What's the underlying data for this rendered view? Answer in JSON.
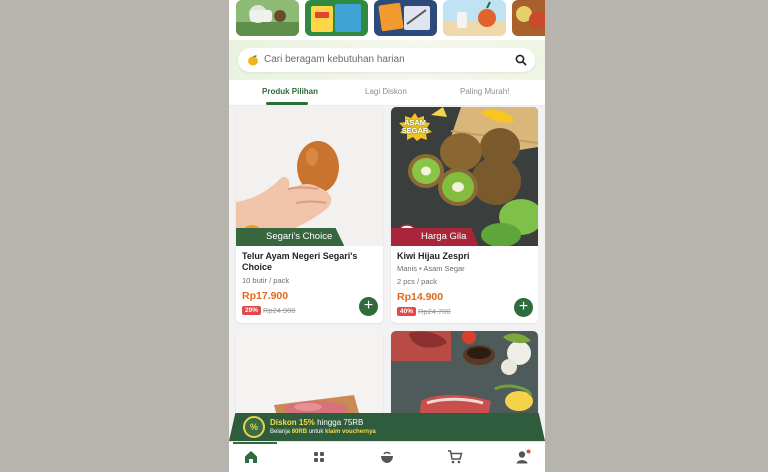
{
  "search": {
    "placeholder": "Cari beragam kebutuhan harian"
  },
  "tabs": [
    {
      "label": "Produk Pilihan",
      "active": true
    },
    {
      "label": "Lagi Diskon",
      "active": false
    },
    {
      "label": "Paling Murah!",
      "active": false
    }
  ],
  "products": [
    {
      "name": "Telur Ayam Negeri Segari's Choice",
      "variant": "",
      "unit": "10 butir / pack",
      "price": "Rp17.900",
      "discount": "29%",
      "old_price": "Rp24.900",
      "ribbon": "Segari's Choice",
      "ribbon_color": "#36673f"
    },
    {
      "name": "Kiwi Hijau Zespri",
      "variant": "Manis • Asam Segar",
      "unit": "2 pcs / pack",
      "price": "Rp14.900",
      "discount": "40%",
      "old_price": "Rp24.700",
      "ribbon": "Harga Gila",
      "ribbon_color": "#a9253a",
      "sticker": {
        "line1": "ASAM",
        "line2": "SEGAR"
      }
    }
  ],
  "promo": {
    "icon_text": "%",
    "line1_a": "Diskon 15%",
    "line1_b": " hingga 75RB",
    "line2_a": "Belanja ",
    "line2_b": "80RB",
    "line2_c": " untuk ",
    "line2_d": "klaim vouchernya"
  },
  "nav": [
    {
      "icon": "home-icon",
      "active": true
    },
    {
      "icon": "category-grid-icon",
      "active": false
    },
    {
      "icon": "recipe-bowl-icon",
      "active": false
    },
    {
      "icon": "cart-icon",
      "active": false
    },
    {
      "icon": "account-icon",
      "active": false,
      "dot": true
    }
  ],
  "colors": {
    "brand_green": "#2f6b3c",
    "price_orange": "#e0681b",
    "discount_red": "#e24a4a",
    "promo_yellow": "#f3dd4c"
  }
}
